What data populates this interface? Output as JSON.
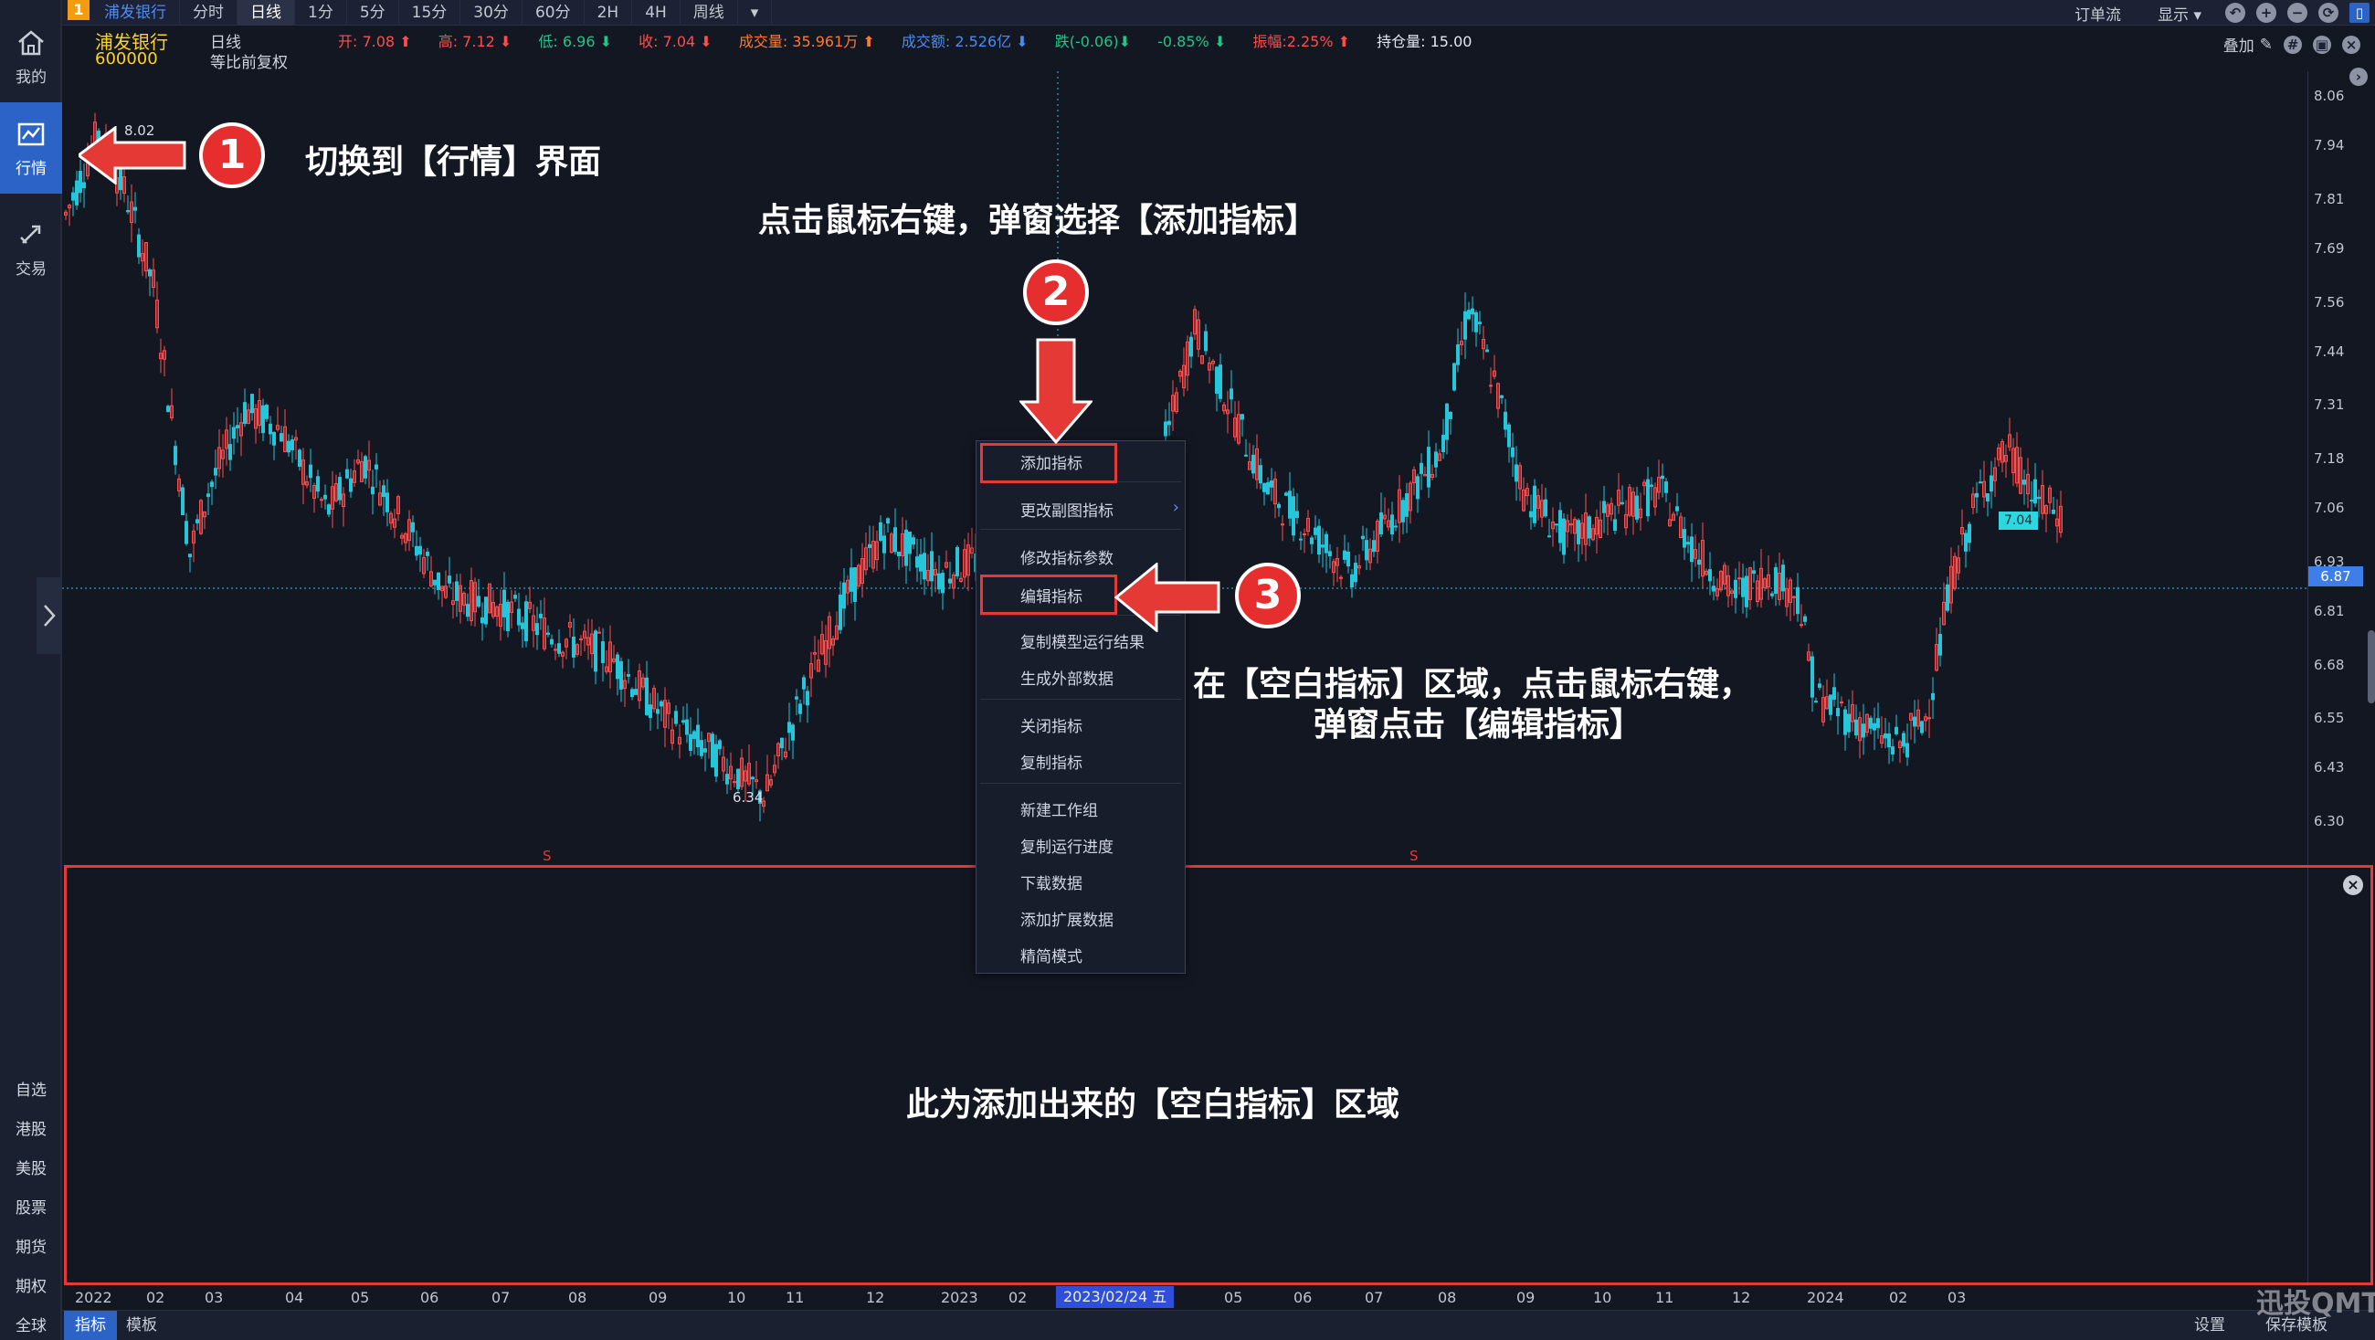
{
  "sidebar": {
    "nav": [
      {
        "id": "home",
        "label": "我的",
        "icon": "home-icon"
      },
      {
        "id": "market",
        "label": "行情",
        "icon": "chart-line-icon",
        "active": true
      },
      {
        "id": "trade",
        "label": "交易",
        "icon": "trade-arrows-icon"
      }
    ],
    "markets": [
      "自选",
      "港股",
      "美股",
      "股票",
      "期货",
      "期权",
      "全球"
    ]
  },
  "topbar": {
    "badge": "1",
    "tabs": [
      "浦发银行",
      "分时",
      "日线",
      "1分",
      "5分",
      "15分",
      "30分",
      "60分",
      "2H",
      "4H",
      "周线"
    ],
    "active_tab": "日线",
    "more": "▾",
    "right": [
      "订单流",
      "显示 ▾"
    ]
  },
  "quote": {
    "name": "浦发银行",
    "code": "600000",
    "period": "日线",
    "adjust": "等比前复权",
    "open": "开: 7.08 ⬆",
    "high": "高: 7.12 ⬇",
    "low": "低: 6.96 ⬇",
    "close": "收: 7.04 ⬇",
    "volume": "成交量: 35.961万 ⬆",
    "amount": "成交额: 2.526亿 ⬇",
    "change": "跌(-0.06)⬇",
    "change_pct": "-0.85% ⬇",
    "amplitude": "振幅:2.25% ⬆",
    "open_interest": "持仓量: 15.00",
    "overlay": "叠加"
  },
  "chart_data": {
    "type": "candlestick",
    "ylim": [
      6.2,
      8.12
    ],
    "yticks": [
      "8.06",
      "7.94",
      "7.81",
      "7.69",
      "7.56",
      "7.44",
      "7.31",
      "7.18",
      "7.06",
      "6.93",
      "6.81",
      "6.68",
      "6.55",
      "6.43",
      "6.30"
    ],
    "current_price": "6.87",
    "last_price_label": "7.04",
    "high_label": "8.02",
    "low_label": "6.34",
    "signals": [
      "S",
      "S"
    ],
    "xticks": [
      "2022",
      "02",
      "03",
      "04",
      "05",
      "06",
      "07",
      "08",
      "09",
      "10",
      "11",
      "12",
      "2023",
      "02",
      "05",
      "06",
      "07",
      "08",
      "09",
      "10",
      "11",
      "12",
      "2024",
      "02",
      "03"
    ],
    "cursor_date": "2023/02/24 五",
    "up_color": "#ff4d4d",
    "down_color": "#26c6da"
  },
  "context_menu": {
    "items": [
      "添加指标",
      "更改副图指标",
      "修改指标参数",
      "编辑指标",
      "复制模型运行结果",
      "生成外部数据",
      "关闭指标",
      "复制指标",
      "新建工作组",
      "复制运行进度",
      "下载数据",
      "添加扩展数据",
      "精简模式"
    ]
  },
  "annotations": {
    "step1": "1",
    "step2": "2",
    "step3": "3",
    "text1": "切换到【行情】界面",
    "text2": "点击鼠标右键，弹窗选择【添加指标】",
    "text3a": "在【空白指标】区域，点击鼠标右键，",
    "text3b": "弹窗点击【编辑指标】",
    "text4": "此为添加出来的【空白指标】区域"
  },
  "bottombar": {
    "tabs": [
      "指标",
      "模板"
    ],
    "settings": "设置",
    "save_template": "保存模板"
  },
  "watermark": "迅投QMT"
}
